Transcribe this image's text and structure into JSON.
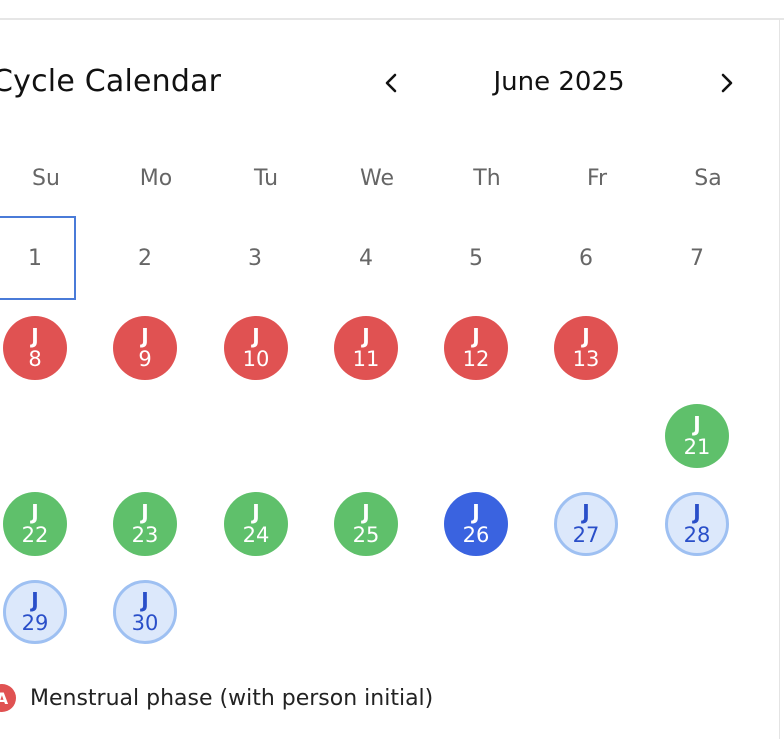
{
  "calendar": {
    "title": "Cycle Calendar",
    "month_label": "June 2025",
    "weekdays": [
      "Su",
      "Mo",
      "Tu",
      "We",
      "Th",
      "Fr",
      "Sa"
    ],
    "plain_days": [
      "1",
      "2",
      "3",
      "4",
      "5",
      "6",
      "7"
    ],
    "selected_day": "1",
    "marked_days": [
      {
        "initial": "J",
        "day": "8",
        "phase": "menstrual"
      },
      {
        "initial": "J",
        "day": "9",
        "phase": "menstrual"
      },
      {
        "initial": "J",
        "day": "10",
        "phase": "menstrual"
      },
      {
        "initial": "J",
        "day": "11",
        "phase": "menstrual"
      },
      {
        "initial": "J",
        "day": "12",
        "phase": "menstrual"
      },
      {
        "initial": "J",
        "day": "13",
        "phase": "menstrual"
      },
      {
        "initial": "J",
        "day": "21",
        "phase": "fertile"
      },
      {
        "initial": "J",
        "day": "22",
        "phase": "fertile"
      },
      {
        "initial": "J",
        "day": "23",
        "phase": "fertile"
      },
      {
        "initial": "J",
        "day": "24",
        "phase": "fertile"
      },
      {
        "initial": "J",
        "day": "25",
        "phase": "fertile"
      },
      {
        "initial": "J",
        "day": "26",
        "phase": "ovulation"
      },
      {
        "initial": "J",
        "day": "27",
        "phase": "predicted"
      },
      {
        "initial": "J",
        "day": "28",
        "phase": "predicted"
      },
      {
        "initial": "J",
        "day": "29",
        "phase": "predicted"
      },
      {
        "initial": "J",
        "day": "30",
        "phase": "predicted"
      }
    ]
  },
  "legend": {
    "badge_letter": "A",
    "text": "Menstrual phase (with person initial)"
  },
  "colors": {
    "menstrual": "#e05252",
    "fertile": "#5fc06b",
    "ovulation": "#3a63e0",
    "predicted_fill": "#dce8fb",
    "predicted_border": "#9ec0f2",
    "selection": "#4a7bd8"
  },
  "icons": {
    "prev": "chevron-left-icon",
    "next": "chevron-right-icon"
  }
}
